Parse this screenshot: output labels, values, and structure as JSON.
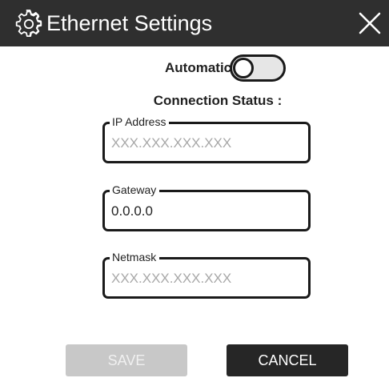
{
  "window": {
    "title": "Ethernet Settings",
    "title_icon": "gear-icon",
    "close_icon": "close-icon"
  },
  "automatic": {
    "label": "Automatic",
    "enabled": false
  },
  "connection_status": {
    "label": "Connection Status :"
  },
  "fields": {
    "ip_address": {
      "label": "IP Address",
      "value": "",
      "placeholder": "XXX.XXX.XXX.XXX"
    },
    "gateway": {
      "label": "Gateway",
      "value": "0.0.0.0",
      "placeholder": ""
    },
    "netmask": {
      "label": "Netmask",
      "value": "",
      "placeholder": "XXX.XXX.XXX.XXX"
    }
  },
  "buttons": {
    "save_label": "SAVE",
    "save_disabled": true,
    "cancel_label": "CANCEL"
  },
  "colors": {
    "titlebar": "#2f2f2f",
    "save_disabled": "#c8c8c8",
    "cancel": "#262626"
  }
}
